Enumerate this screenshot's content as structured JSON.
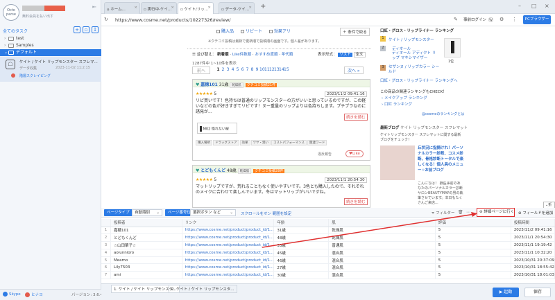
{
  "app": {
    "logo_text": "Octo parse",
    "user_plan": "無料会員を払い出す",
    "version": "バージョン: 3.6.4",
    "footer_items": [
      {
        "label": "Skype"
      },
      {
        "label": "ヒナヨ"
      }
    ]
  },
  "sidebar": {
    "task_header": "全てのタスク",
    "tree": [
      {
        "label": "test",
        "level": 0
      },
      {
        "label": "Samples",
        "level": 0
      },
      {
        "label": "デフォルト",
        "level": 0,
        "selected": true
      }
    ],
    "task": {
      "title": "ケイト / ケイト リップモンスター スフレマ...",
      "type": "データ収集",
      "date": "2023-11-02 11:2:15",
      "status": "階層スクレイピング"
    }
  },
  "browser": {
    "tabs": [
      {
        "label": "ホーム..."
      },
      {
        "label": "実行中-ケイ..."
      },
      {
        "label": "ケイト/リッ...",
        "active": true
      },
      {
        "label": "データ-ケイ..."
      }
    ],
    "url": "https://www.cosme.net/products/10227326/review/",
    "login_label": "事前ログイン",
    "pc_label": "PCブラウザー"
  },
  "webpage": {
    "filters": [
      "購入品",
      "リピート",
      "効果アリ"
    ],
    "search_btn": "＋ 条件で絞る",
    "search_note": "※クチコミ投稿は最新で更新順で投稿順の画面です。個人差があります。",
    "sort_label": "並び替え：",
    "sort_options": [
      "新着順",
      "Like件数順",
      "おすすめ度順",
      "年代順"
    ],
    "display_label": "表示形式：",
    "display_options": [
      "リスト",
      "全文"
    ],
    "count": "1287件中 1~10件を表示",
    "prev": "前へ",
    "next": "次へ",
    "pages": [
      "1",
      "2",
      "3",
      "4",
      "5",
      "6",
      "7",
      "8",
      "9",
      "10",
      "11",
      "12",
      "13",
      "14",
      "15"
    ],
    "reviews": [
      {
        "author": "嘉穂101",
        "age": "31歳",
        "skin": "乾燥肌",
        "badge": "クチコミ投稿21件",
        "rating": "5",
        "date": "2023/11/2 09:41:16",
        "text": "リピ買いです！色持ちは普通のリップモンスターの方がいいと思っているのですが、この軽いなどの色が好きすぎてリピです！ヌー重量のリップよりは色持ちします。プチプラなのに誘発が...",
        "more": "続きを読む",
        "product": "M02 怪れない桜",
        "tags": [
          "購入場所",
          "ドラッグストア",
          "効果",
          "ツヤ・潤い",
          "コストパフォーマンス",
          "関連ワード"
        ],
        "report": "違反報告",
        "like": "Like"
      },
      {
        "author": "とどもくんど",
        "age": "48歳",
        "skin": "乾燥肌",
        "badge": "クチコミ投稿28件",
        "rating": "5",
        "date": "2023/11/1 20:54:30",
        "text": "マットリップですが、荒れることもなく使いやすいです。3色とも購入したので、それぞれのメイクに合わせて楽しんでいます。冬はマットリップがいいですね。",
        "more": "続きを読む"
      }
    ],
    "right": {
      "ranking_title": "口紅・グロス・リップライナー ランキング",
      "rank1": "ケイト / リップモンスター",
      "rank2_brand": "ディオール",
      "rank2_product": "ディオール アディクト リップ マキシマイザー",
      "rank3": "セザンヌ / リップカラー シールド",
      "rank_badge": "1位",
      "ranking_link": "口紅・グロス・リップライナー ランキングへ",
      "check": "この商品の関連ランキングもCHECK！",
      "check_links": [
        "メイクアップ ランキング",
        "口紅 ランキング"
      ],
      "twitter": "@cosmeのランキングとは",
      "blog_label": "最新ブログ",
      "blog_sub": "ケイト リップモンスター スフレマット",
      "blog_desc": "ケイトリップモンスター スフレマットに関する最新ブログをチェック！",
      "blog_title": "丘状況に指摘けれ！パーソナルカラー診断、コスメ診断、骨格診断トータルで楽しくなる！個人具のメニュー☆お前ブログ",
      "blog_body": "こんにちは！ 癖医事前のあなたのパーソナルカラー診断サロンBEAUTYMAPの男の執筆させています。本日もたくさんご来店..."
    }
  },
  "panel": {
    "page_type_label": "ページタイプ",
    "page_type_value": "自動識別",
    "paging_label": "ページ番号位置",
    "paging_value": "選択ボタン など",
    "scroll_link": "スクロールをオン 範囲を設定",
    "filter_label": "フィルター",
    "detail_btn": "詳細ページに行く",
    "add_field": "フィールドを追加",
    "close_label": "折る",
    "columns": [
      "",
      "投稿者",
      "リンク",
      "年齢",
      "肌",
      "評価",
      "投稿時間"
    ],
    "rows": [
      {
        "n": "1",
        "author": "嘉穂101",
        "link": "https://www.cosme.net/product/product_id/1...",
        "age": "31歳",
        "skin": "乾燥肌",
        "rating": "5",
        "time": "2023/11/2 09:41:16"
      },
      {
        "n": "2",
        "author": "とどもくんど",
        "link": "https://www.cosme.net/product/product_id/1...",
        "age": "48歳",
        "skin": "乾燥肌",
        "rating": "5",
        "time": "2023/11/1 20:54:30"
      },
      {
        "n": "3",
        "author": "☆山田華子☆",
        "link": "https://www.cosme.net/product/product_id/1...",
        "age": "33歳",
        "skin": "普通肌",
        "rating": "5",
        "time": "2023/11/1 19:19:42"
      },
      {
        "n": "4",
        "author": "aoiunnioro",
        "link": "https://www.cosme.net/product/product_id/1...",
        "age": "45歳",
        "skin": "混合肌",
        "rating": "5",
        "time": "2023/11/1 10:32:20"
      },
      {
        "n": "5",
        "author": "Meamo",
        "link": "https://www.cosme.net/product/product_id/1...",
        "age": "46歳",
        "skin": "混合肌",
        "rating": "5",
        "time": "2023/10/31 20:37:09"
      },
      {
        "n": "6",
        "author": "Lily7503",
        "link": "https://www.cosme.net/product/product_id/1...",
        "age": "27歳",
        "skin": "混合肌",
        "rating": "5",
        "time": "2023/10/31 18:55:42"
      },
      {
        "n": "7",
        "author": "ami",
        "link": "https://www.cosme.net/product/product_id/1...",
        "age": "30歳",
        "skin": "混合肌",
        "rating": "5",
        "time": "2023/10/31 18:01:03"
      }
    ]
  },
  "footer": {
    "tabs": [
      {
        "label": "1. ケイト / ケイト リップモンスタ...",
        "active": true
      },
      {
        "label": "2. ケイト / ケイト リップモンスタ..."
      }
    ],
    "start": "▶ 起動",
    "save": "保存"
  },
  "colors": {
    "accent": "#2c7be5",
    "arrow": "#e03030",
    "review_header": "#eef6e6"
  }
}
